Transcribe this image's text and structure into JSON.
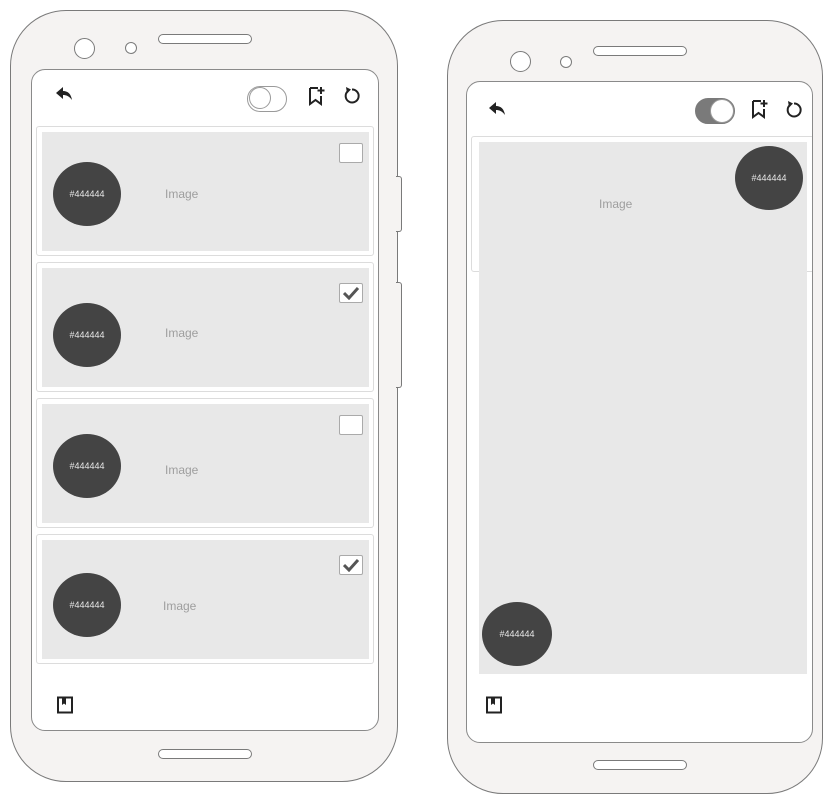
{
  "colors": {
    "avatar": "#444444",
    "image_bg": "#e8e8e8",
    "phone_body": "#f5f3f2"
  },
  "icons": [
    "back-arrow-icon",
    "toggle-switch",
    "bookmark-add-icon",
    "refresh-icon",
    "bookmark-icon",
    "checkmark-icon"
  ],
  "phone_left": {
    "toggle_on": false,
    "cards": [
      {
        "avatar_label": "#444444",
        "image_label": "Image",
        "checked": false
      },
      {
        "avatar_label": "#444444",
        "image_label": "Image",
        "checked": true
      },
      {
        "avatar_label": "#444444",
        "image_label": "Image",
        "checked": false
      },
      {
        "avatar_label": "#444444",
        "image_label": "Image",
        "checked": true
      }
    ]
  },
  "phone_right": {
    "toggle_on": true,
    "image_label": "Image",
    "avatar_top_label": "#444444",
    "avatar_bottom_label": "#444444"
  }
}
